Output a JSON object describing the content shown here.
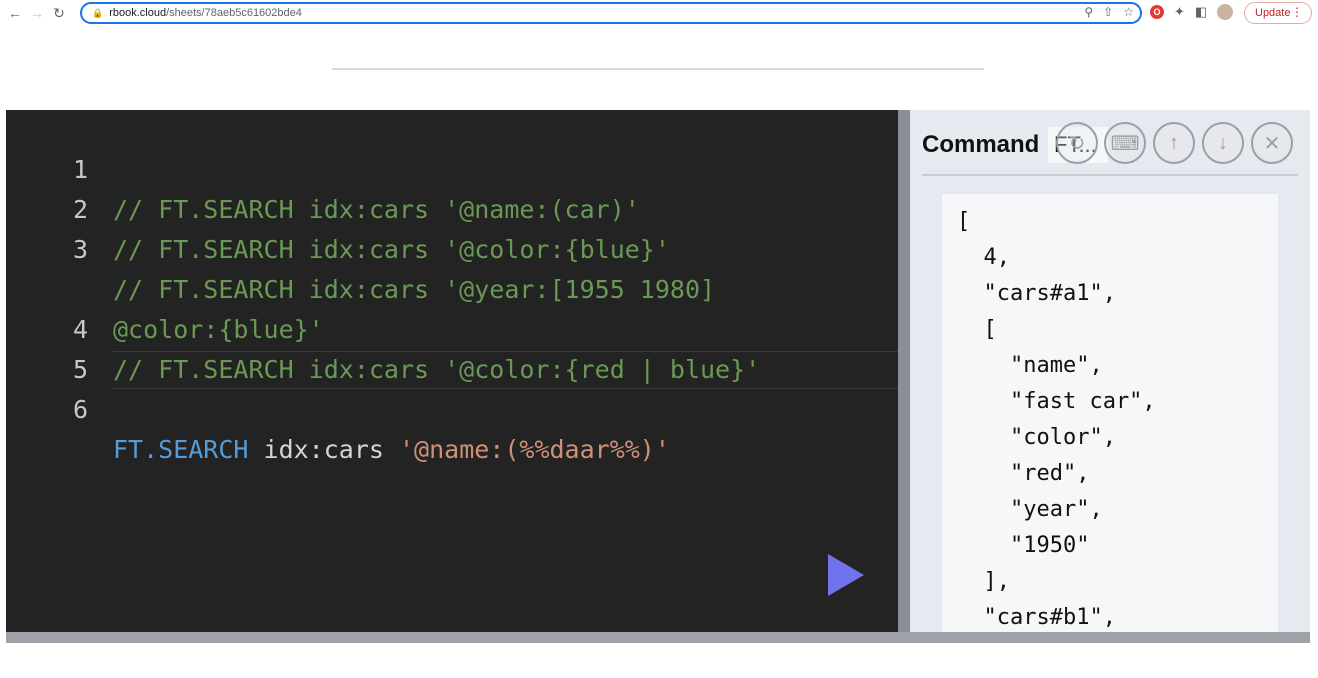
{
  "browser": {
    "url_host": "rbook.cloud",
    "url_path": "/sheets/78aeb5c61602bde4",
    "update_label": "Update",
    "icons": [
      "back-icon",
      "forward-icon",
      "reload-icon",
      "lock-icon",
      "zoom-icon",
      "share-icon",
      "star-icon",
      "extension-icon",
      "puzzle-icon",
      "sidebar-icon",
      "avatar",
      "menu-icon"
    ]
  },
  "editor": {
    "lines": [
      {
        "num": "1",
        "comment": "// FT.SEARCH idx:cars '@name:(car)'"
      },
      {
        "num": "2",
        "comment": "// FT.SEARCH idx:cars '@color:{blue}'"
      },
      {
        "num": "3",
        "comment": "// FT.SEARCH idx:cars '@year:[1955 1980]"
      },
      {
        "num": "",
        "comment": "@color:{blue}'"
      },
      {
        "num": "4",
        "comment": "// FT.SEARCH idx:cars '@color:{red | blue}'"
      },
      {
        "num": "5",
        "comment": ""
      },
      {
        "num": "6",
        "kw": "FT.SEARCH",
        "plain": " idx:cars ",
        "str": "'@name:(%%daar%%)'"
      }
    ],
    "colors": {
      "comment": "#6a9955",
      "keyword": "#569cd6",
      "string": "#ce9178",
      "background": "#232323"
    }
  },
  "side": {
    "label": "Command",
    "value": "FT...",
    "buttons": [
      "history-icon",
      "paint-roller-icon",
      "arrow-up-icon",
      "arrow-down-icon",
      "close-icon"
    ],
    "output": [
      "[",
      "  4,",
      "  \"cars#a1\",",
      "  [",
      "    \"name\",",
      "    \"fast car\",",
      "    \"color\",",
      "    \"red\",",
      "    \"year\",",
      "    \"1950\"",
      "  ],",
      "  \"cars#b1\","
    ]
  },
  "run_color": "#7073ec"
}
